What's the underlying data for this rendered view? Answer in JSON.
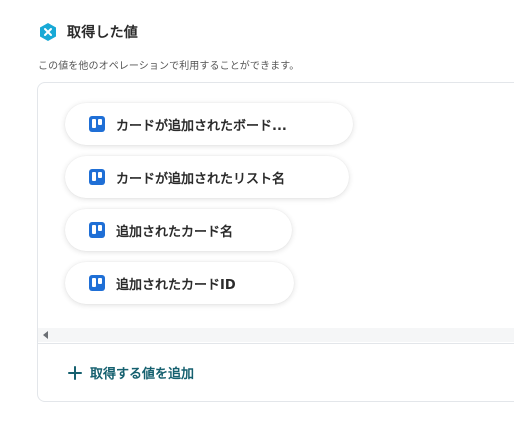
{
  "header": {
    "title": "取得した値",
    "description": "この値を他のオペレーションで利用することができます。",
    "icon": "yoom-badge-icon",
    "icon_color": "#18a9d6"
  },
  "values": {
    "items": [
      {
        "label": "カードが追加されたボード...",
        "icon": "trello-icon"
      },
      {
        "label": "カードが追加されたリスト名",
        "icon": "trello-icon"
      },
      {
        "label": "追加されたカード名",
        "icon": "trello-icon"
      },
      {
        "label": "追加されたカードID",
        "icon": "trello-icon"
      }
    ]
  },
  "actions": {
    "add_label": "取得する値を追加",
    "accent_color": "#15606f"
  }
}
